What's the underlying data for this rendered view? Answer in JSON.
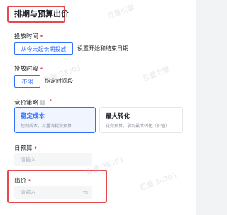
{
  "section": {
    "title": "排期与预算出价"
  },
  "schedule": {
    "label": "投放时间",
    "options": [
      "从今天起长期投放",
      "设置开始和结束日期"
    ]
  },
  "time_slot": {
    "label": "投放时段",
    "options": [
      "不限",
      "指定时间段"
    ]
  },
  "strategy": {
    "label": "竞价策略",
    "cards": [
      {
        "title": "稳定成本",
        "desc": "控制成本，尽量消耗完预算"
      },
      {
        "title": "最大转化",
        "desc": "花完预算，拿到最大转化（价值）"
      }
    ]
  },
  "daily_budget": {
    "label": "日预算",
    "placeholder": "请输入"
  },
  "bid": {
    "label": "出价",
    "placeholder": "请输入",
    "suffix": "元"
  },
  "watermarks": [
    "巨量引擎",
    "巨量引擎",
    "巨量 38303",
    "巨量 38303",
    "巨量 38303"
  ],
  "colors": {
    "accent": "#3370ff",
    "required": "#e5484d",
    "highlight_border": "#e5484d"
  }
}
